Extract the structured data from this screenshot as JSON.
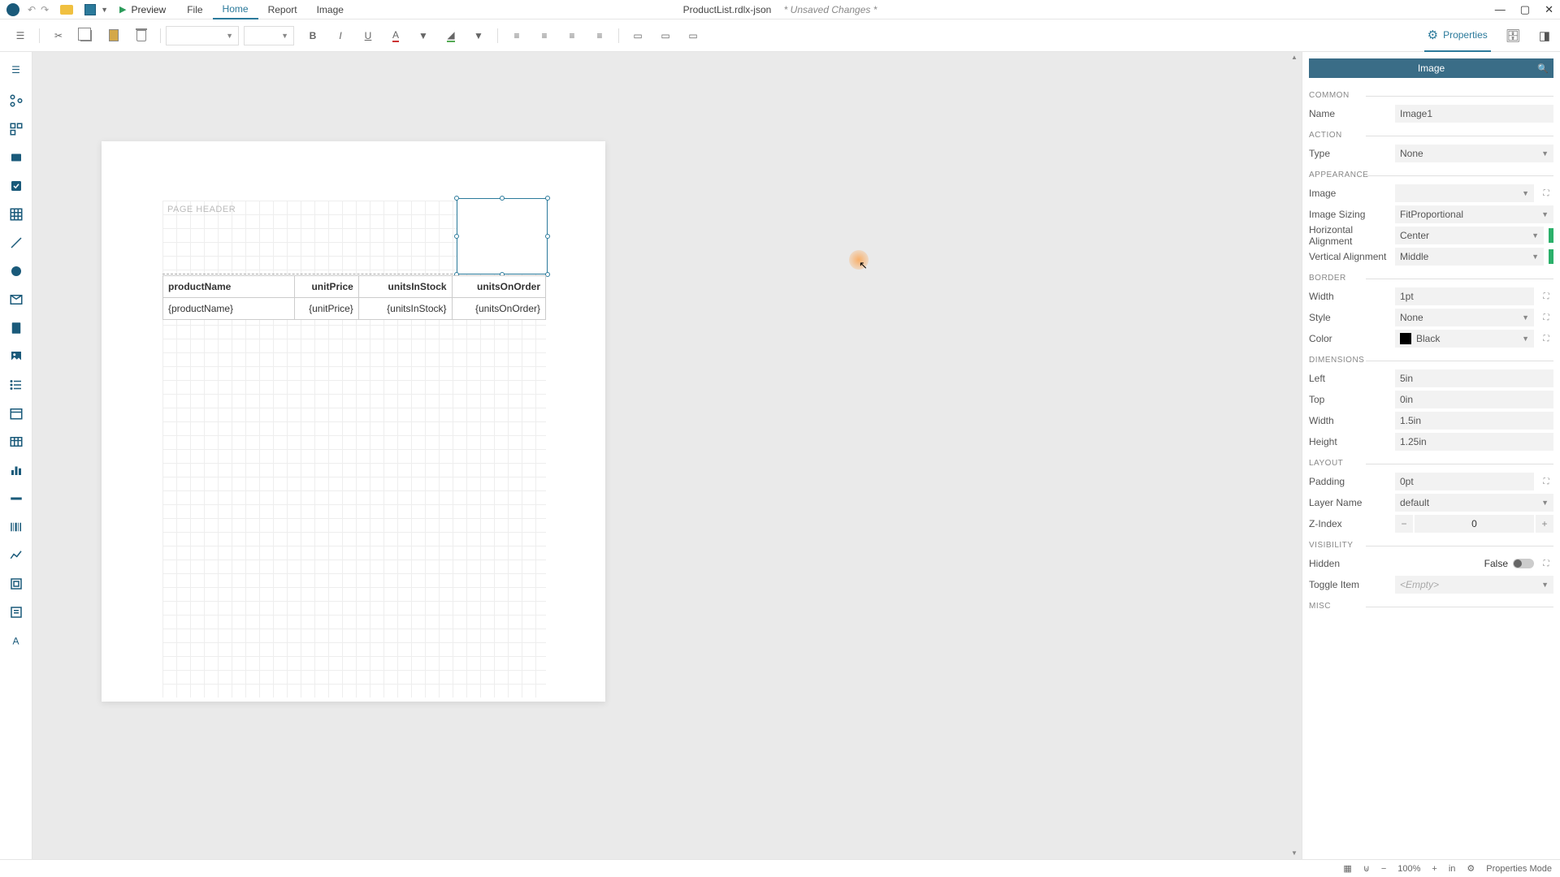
{
  "menubar": {
    "preview": "Preview",
    "items": [
      "File",
      "Home",
      "Report",
      "Image"
    ],
    "active": "Home",
    "doc_title": "ProductList.rdlx-json",
    "doc_status": "* Unsaved Changes *"
  },
  "toolbar": {
    "right_tabs": {
      "properties": "Properties"
    }
  },
  "canvas": {
    "page_header_label": "PAGE HEADER",
    "table": {
      "headers": [
        "productName",
        "unitPrice",
        "unitsInStock",
        "unitsOnOrder"
      ],
      "row": [
        "{productName}",
        "{unitPrice}",
        "{unitsInStock}",
        "{unitsOnOrder}"
      ]
    }
  },
  "props": {
    "title": "Image",
    "sections": {
      "common": {
        "title": "COMMON",
        "name_label": "Name",
        "name_value": "Image1"
      },
      "action": {
        "title": "ACTION",
        "type_label": "Type",
        "type_value": "None"
      },
      "appearance": {
        "title": "APPEARANCE",
        "image_label": "Image",
        "image_value": "",
        "sizing_label": "Image Sizing",
        "sizing_value": "FitProportional",
        "halign_label": "Horizontal Alignment",
        "halign_value": "Center",
        "valign_label": "Vertical Alignment",
        "valign_value": "Middle"
      },
      "border": {
        "title": "BORDER",
        "width_label": "Width",
        "width_value": "1pt",
        "style_label": "Style",
        "style_value": "None",
        "color_label": "Color",
        "color_value": "Black"
      },
      "dimensions": {
        "title": "DIMENSIONS",
        "left_label": "Left",
        "left_value": "5in",
        "top_label": "Top",
        "top_value": "0in",
        "width_label": "Width",
        "width_value": "1.5in",
        "height_label": "Height",
        "height_value": "1.25in"
      },
      "layout": {
        "title": "LAYOUT",
        "padding_label": "Padding",
        "padding_value": "0pt",
        "layer_label": "Layer Name",
        "layer_value": "default",
        "zindex_label": "Z-Index",
        "zindex_value": "0"
      },
      "visibility": {
        "title": "VISIBILITY",
        "hidden_label": "Hidden",
        "hidden_value": "False",
        "toggle_label": "Toggle Item",
        "toggle_value": "<Empty>"
      },
      "misc": {
        "title": "MISC"
      }
    }
  },
  "statusbar": {
    "zoom": "100%",
    "unit": "in",
    "mode": "Properties Mode"
  }
}
